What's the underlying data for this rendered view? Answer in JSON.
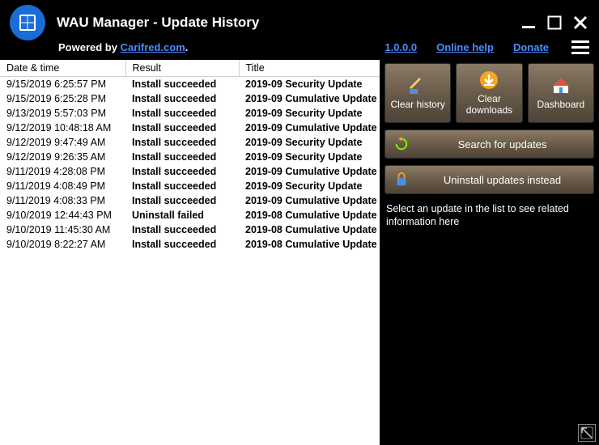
{
  "window": {
    "title": "WAU Manager - Update History",
    "powered_prefix": "Powered by ",
    "powered_link": "Carifred.com",
    "powered_suffix": ".",
    "version": "1.0.0.0",
    "help_link": "Online help",
    "donate_link": "Donate"
  },
  "table": {
    "headers": {
      "datetime": "Date & time",
      "result": "Result",
      "title": "Title"
    },
    "rows": [
      {
        "datetime": "9/15/2019 6:25:57 PM",
        "result": "Install succeeded",
        "title": "2019-09 Security Update"
      },
      {
        "datetime": "9/15/2019 6:25:28 PM",
        "result": "Install succeeded",
        "title": "2019-09 Cumulative Update"
      },
      {
        "datetime": "9/13/2019 5:57:03 PM",
        "result": "Install succeeded",
        "title": "2019-09 Security Update"
      },
      {
        "datetime": "9/12/2019 10:48:18 AM",
        "result": "Install succeeded",
        "title": "2019-09 Cumulative Update"
      },
      {
        "datetime": "9/12/2019 9:47:49 AM",
        "result": "Install succeeded",
        "title": "2019-09 Security Update"
      },
      {
        "datetime": "9/12/2019 9:26:35 AM",
        "result": "Install succeeded",
        "title": "2019-09 Security Update"
      },
      {
        "datetime": "9/11/2019 4:28:08 PM",
        "result": "Install succeeded",
        "title": "2019-09 Cumulative Update"
      },
      {
        "datetime": "9/11/2019 4:08:49 PM",
        "result": "Install succeeded",
        "title": "2019-09 Security Update"
      },
      {
        "datetime": "9/11/2019 4:08:33 PM",
        "result": "Install succeeded",
        "title": "2019-09 Cumulative Update"
      },
      {
        "datetime": "9/10/2019 12:44:43 PM",
        "result": "Uninstall failed",
        "title": "2019-08 Cumulative Update"
      },
      {
        "datetime": "9/10/2019 11:45:30 AM",
        "result": "Install succeeded",
        "title": "2019-08 Cumulative Update"
      },
      {
        "datetime": "9/10/2019 8:22:27 AM",
        "result": "Install succeeded",
        "title": "2019-08 Cumulative Update"
      }
    ]
  },
  "side": {
    "clear_history": "Clear history",
    "clear_downloads": "Clear downloads",
    "dashboard": "Dashboard",
    "search_updates": "Search for updates",
    "uninstall_instead": "Uninstall updates instead",
    "hint": "Select an update in the list to see related information here"
  }
}
